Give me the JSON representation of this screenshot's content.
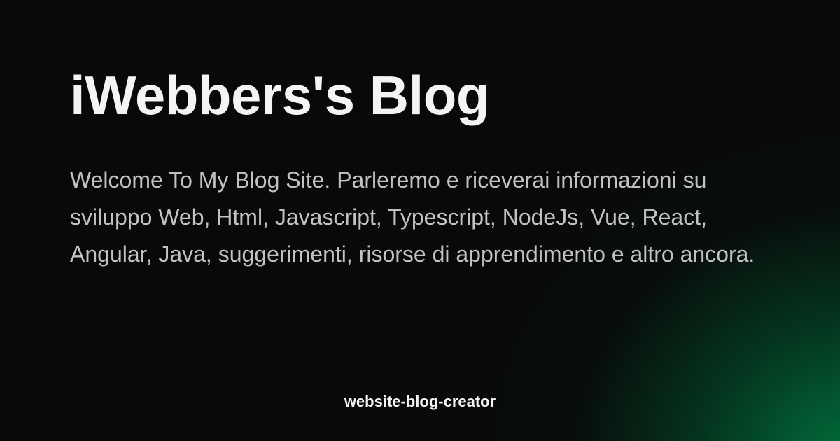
{
  "title": "iWebbers's Blog",
  "description": "Welcome To My Blog Site. Parleremo e riceverai informazioni su sviluppo Web, Html, Javascript, Typescript, NodeJs, Vue, React, Angular, Java, suggerimenti, risorse di apprendimento e altro ancora.",
  "footer": "website-blog-creator",
  "colors": {
    "background": "#090909",
    "accent_glow": "#007640",
    "title": "#f4f4f5",
    "description": "#c2c2c4"
  }
}
